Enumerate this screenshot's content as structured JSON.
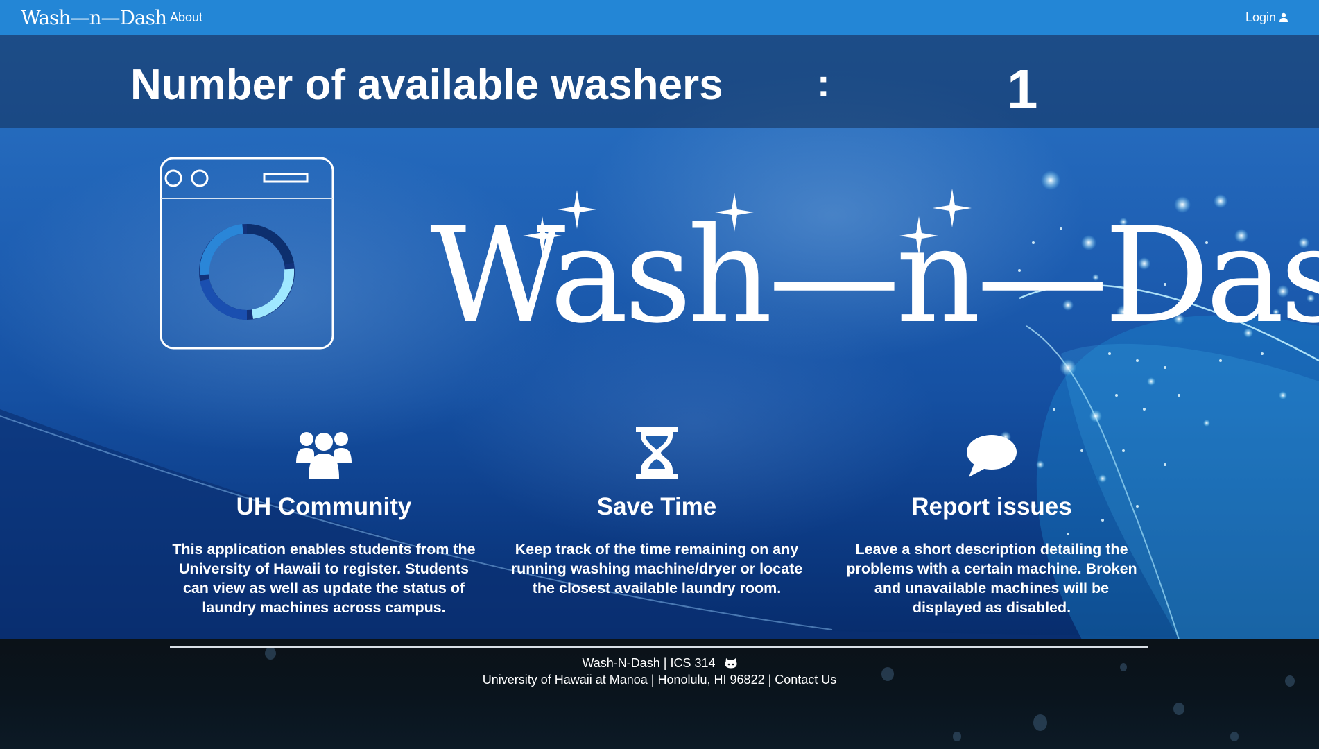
{
  "navbar": {
    "brand": "Wash—n—Dash",
    "about": "About",
    "login": "Login"
  },
  "counter": {
    "label": "Number of available washers",
    "colon": ":",
    "value": "1"
  },
  "hero": {
    "title": "Wash—n—Dash"
  },
  "features": [
    {
      "icon": "users-icon",
      "title": "UH Community",
      "text": "This application enables students from the University of Hawaii to register.  Students can view as well as update the status of laundry machines across campus."
    },
    {
      "icon": "hourglass-icon",
      "title": "Save Time",
      "text": "Keep track of the time remaining on any running washing machine/dryer or locate the closest available laundry room."
    },
    {
      "icon": "speech-bubble-icon",
      "title": "Report issues",
      "text": "Leave a short description detailing the problems with a certain machine.   Broken and unavailable machines will be displayed as disabled."
    }
  ],
  "footer": {
    "line1": "Wash-N-Dash | ICS 314",
    "line2": "University of Hawaii at Manoa | Honolulu, HI 96822 | Contact Us"
  },
  "colors": {
    "navbar": "#2386d6",
    "accent_light": "#9fe8ff",
    "accent_dark": "#0d2f6e"
  }
}
